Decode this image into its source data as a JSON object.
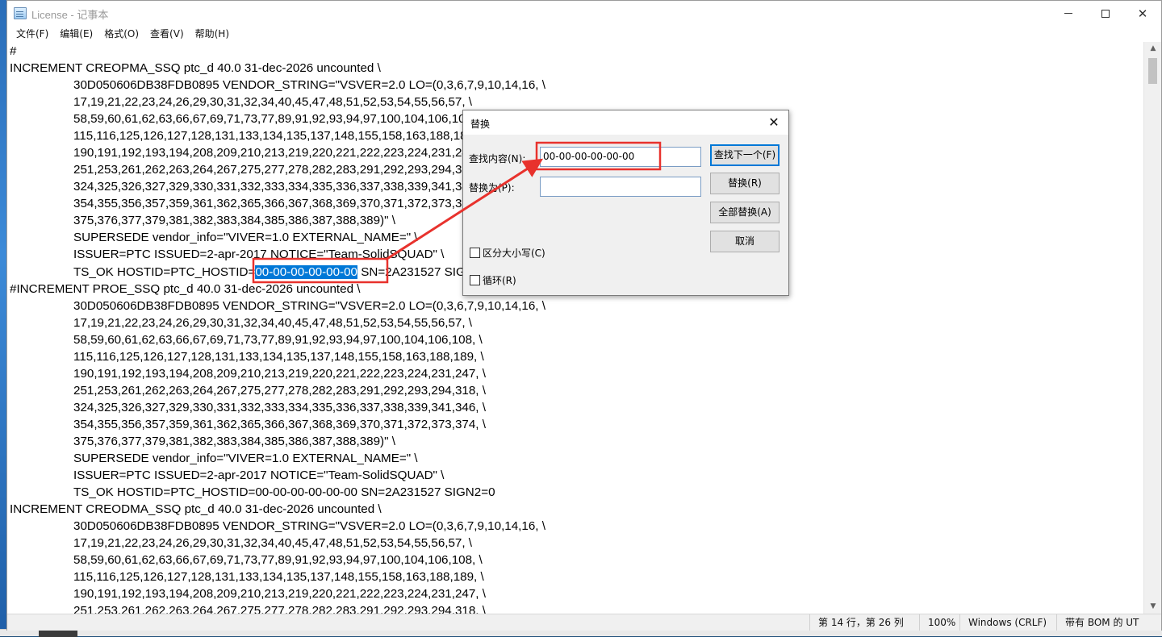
{
  "window": {
    "title": "License - 记事本",
    "app_icon": "notepad-icon"
  },
  "menu": [
    "文件(F)",
    "编辑(E)",
    "格式(O)",
    "查看(V)",
    "帮助(H)"
  ],
  "editor": {
    "lines": [
      {
        "t": "#",
        "indent": false
      },
      {
        "t": "INCREMENT CREOPMA_SSQ ptc_d 40.0 31-dec-2026 uncounted \\",
        "indent": false
      },
      {
        "t": "30D050606DB38FDB0895 VENDOR_STRING=\"VSVER=2.0 LO=(0,3,6,7,9,10,14,16, \\",
        "indent": true
      },
      {
        "t": "17,19,21,22,23,24,26,29,30,31,32,34,40,45,47,48,51,52,53,54,55,56,57, \\",
        "indent": true
      },
      {
        "t": "58,59,60,61,62,63,66,67,69,71,73,77,89,91,92,93,94,97,100,104,106,108, \\",
        "indent": true
      },
      {
        "t": "115,116,125,126,127,128,131,133,134,135,137,148,155,158,163,188,189, \\",
        "indent": true
      },
      {
        "t": "190,191,192,193,194,208,209,210,213,219,220,221,222,223,224,231,247, \\",
        "indent": true
      },
      {
        "t": "251,253,261,262,263,264,267,275,277,278,282,283,291,292,293,294,318, \\",
        "indent": true
      },
      {
        "t": "324,325,326,327,329,330,331,332,333,334,335,336,337,338,339,341,346, \\",
        "indent": true
      },
      {
        "t": "354,355,356,357,359,361,362,365,366,367,368,369,370,371,372,373,374, \\",
        "indent": true
      },
      {
        "t": "375,376,377,379,381,382,383,384,385,386,387,388,389)\" \\",
        "indent": true
      },
      {
        "t": "SUPERSEDE vendor_info=\"VIVER=1.0 EXTERNAL_NAME=\" \\",
        "indent": true
      },
      {
        "t": "ISSUER=PTC ISSUED=2-apr-2017 NOTICE=\"Team-SolidSQUAD\" \\",
        "indent": true
      },
      {
        "t": "",
        "indent": true,
        "pre": "TS_OK HOSTID=PTC_HOSTID=",
        "selected": "00-00-00-00-00-00",
        "post": " SN=2A231527 SIGN2=0"
      },
      {
        "t": "#INCREMENT PROE_SSQ ptc_d 40.0 31-dec-2026 uncounted \\",
        "indent": false
      },
      {
        "t": "30D050606DB38FDB0895 VENDOR_STRING=\"VSVER=2.0 LO=(0,3,6,7,9,10,14,16, \\",
        "indent": true
      },
      {
        "t": "17,19,21,22,23,24,26,29,30,31,32,34,40,45,47,48,51,52,53,54,55,56,57, \\",
        "indent": true
      },
      {
        "t": "58,59,60,61,62,63,66,67,69,71,73,77,89,91,92,93,94,97,100,104,106,108, \\",
        "indent": true
      },
      {
        "t": "115,116,125,126,127,128,131,133,134,135,137,148,155,158,163,188,189, \\",
        "indent": true
      },
      {
        "t": "190,191,192,193,194,208,209,210,213,219,220,221,222,223,224,231,247, \\",
        "indent": true
      },
      {
        "t": "251,253,261,262,263,264,267,275,277,278,282,283,291,292,293,294,318, \\",
        "indent": true
      },
      {
        "t": "324,325,326,327,329,330,331,332,333,334,335,336,337,338,339,341,346, \\",
        "indent": true
      },
      {
        "t": "354,355,356,357,359,361,362,365,366,367,368,369,370,371,372,373,374, \\",
        "indent": true
      },
      {
        "t": "375,376,377,379,381,382,383,384,385,386,387,388,389)\" \\",
        "indent": true
      },
      {
        "t": "SUPERSEDE vendor_info=\"VIVER=1.0 EXTERNAL_NAME=\" \\",
        "indent": true
      },
      {
        "t": "ISSUER=PTC ISSUED=2-apr-2017 NOTICE=\"Team-SolidSQUAD\" \\",
        "indent": true
      },
      {
        "t": "TS_OK HOSTID=PTC_HOSTID=00-00-00-00-00-00 SN=2A231527 SIGN2=0",
        "indent": true
      },
      {
        "t": "INCREMENT CREODMA_SSQ ptc_d 40.0 31-dec-2026 uncounted \\",
        "indent": false
      },
      {
        "t": "30D050606DB38FDB0895 VENDOR_STRING=\"VSVER=2.0 LO=(0,3,6,7,9,10,14,16, \\",
        "indent": true
      },
      {
        "t": "17,19,21,22,23,24,26,29,30,31,32,34,40,45,47,48,51,52,53,54,55,56,57, \\",
        "indent": true
      },
      {
        "t": "58,59,60,61,62,63,66,67,69,71,73,77,89,91,92,93,94,97,100,104,106,108, \\",
        "indent": true
      },
      {
        "t": "115,116,125,126,127,128,131,133,134,135,137,148,155,158,163,188,189, \\",
        "indent": true
      },
      {
        "t": "190,191,192,193,194,208,209,210,213,219,220,221,222,223,224,231,247, \\",
        "indent": true
      },
      {
        "t": "251,253,261,262,263,264,267,275,277,278,282,283,291,292,293,294,318, \\",
        "indent": true
      }
    ]
  },
  "status": {
    "position": "第 14 行，第 26 列",
    "zoom": "100%",
    "line_ending": "Windows (CRLF)",
    "encoding": "带有 BOM 的 UT"
  },
  "dialog": {
    "title": "替换",
    "find_label": "查找内容(N):",
    "find_value": "00-00-00-00-00-00",
    "replace_label": "替换为(P):",
    "replace_value": "",
    "find_next_btn": "查找下一个(F)",
    "replace_btn": "替换(R)",
    "replace_all_btn": "全部替换(A)",
    "cancel_btn": "取消",
    "match_case_label": "区分大小写(C)",
    "match_case_checked": false,
    "wrap_label": "循环(R)",
    "wrap_checked": false
  },
  "colors": {
    "selection": "#0078d7",
    "annotation": "#e8322d"
  }
}
